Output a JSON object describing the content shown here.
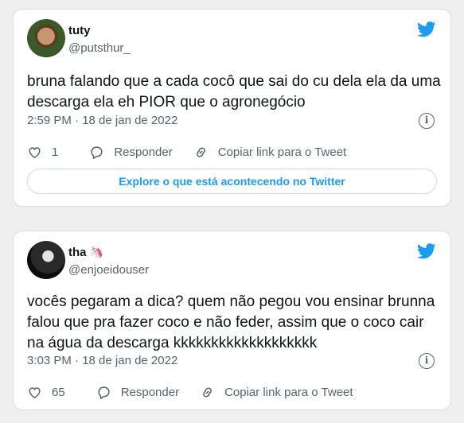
{
  "tweets": [
    {
      "name": "tuty",
      "handle": "@putsthur_",
      "text": "bruna falando que a cada cocô que sai do cu dela ela da uma descarga ela eh PIOR que o agronegócio",
      "timestamp": "2:59 PM · 18 de jan de 2022",
      "likes": "1",
      "reply_label": "Responder",
      "copy_label": "Copiar link para o Tweet",
      "explore_label": "Explore o que está acontecendo no Twitter"
    },
    {
      "name": "tha",
      "name_emoji": "🦄",
      "handle": "@enjoeidouser",
      "text": "vocês pegaram a dica? quem não pegou vou ensinar brunna falou que pra fazer coco e não feder, assim que o coco cair na água da descarga kkkkkkkkkkkkkkkkkkk",
      "timestamp": "3:03 PM · 18 de jan de 2022",
      "likes": "65",
      "reply_label": "Responder",
      "copy_label": "Copiar link para o Tweet"
    }
  ],
  "icons": {
    "brand": "twitter-bird-icon",
    "like": "heart-icon",
    "reply": "reply-bubble-icon",
    "copy": "link-icon",
    "info": "info-icon"
  },
  "colors": {
    "brand_blue": "#1d9bf0",
    "text": "#0f1419",
    "secondary": "#536471",
    "background": "#efefef"
  }
}
